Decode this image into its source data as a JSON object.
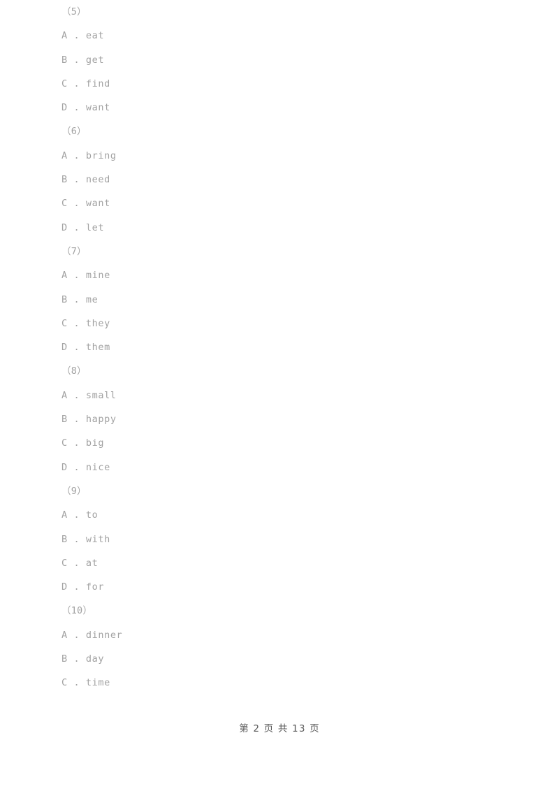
{
  "document": {
    "background_color": "#ffffff",
    "body_text_color": "#a2a2a2",
    "footer_text_color": "#585858"
  },
  "questions": [
    {
      "number_label": "（5）",
      "options": [
        "A . eat",
        "B . get",
        "C . find",
        "D . want"
      ]
    },
    {
      "number_label": "（6）",
      "options": [
        "A . bring",
        "B . need",
        "C . want",
        "D . let"
      ]
    },
    {
      "number_label": "（7）",
      "options": [
        "A . mine",
        "B . me",
        "C . they",
        "D . them"
      ]
    },
    {
      "number_label": "（8）",
      "options": [
        "A . small",
        "B . happy",
        "C . big",
        "D . nice"
      ]
    },
    {
      "number_label": "（9）",
      "options": [
        "A . to",
        "B . with",
        "C . at",
        "D . for"
      ]
    },
    {
      "number_label": "（10）",
      "options": [
        "A . dinner",
        "B . day",
        "C . time"
      ]
    }
  ],
  "footer": {
    "text": "第 2 页 共 13 页",
    "current_page": "2",
    "total_pages": "13"
  }
}
